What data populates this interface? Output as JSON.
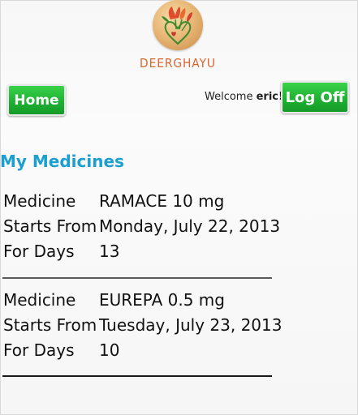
{
  "app": {
    "brand_name": "DEERGHAYU",
    "logo_icon": "flower-heart-logo-icon"
  },
  "header": {
    "home_label": "Home",
    "welcome_prefix": "Welcome",
    "username": "eric!",
    "logoff_label": "Log Off"
  },
  "main": {
    "title": "My Medicines",
    "medicines": [
      {
        "medicine_label": "Medicine",
        "medicine_value": "RAMACE 10 mg",
        "starts_label": "Starts From",
        "starts_value": "Monday, July 22, 2013",
        "days_label": "For Days",
        "days_value": "13"
      },
      {
        "medicine_label": "Medicine",
        "medicine_value": "EUREPA 0.5 mg",
        "starts_label": "Starts From",
        "starts_value": "Tuesday, July 23, 2013",
        "days_label": "For Days",
        "days_value": "10"
      }
    ]
  },
  "colors": {
    "accent_green": "#1fb133",
    "title_blue": "#1a9fd0",
    "brand_orange": "#d8672f"
  }
}
